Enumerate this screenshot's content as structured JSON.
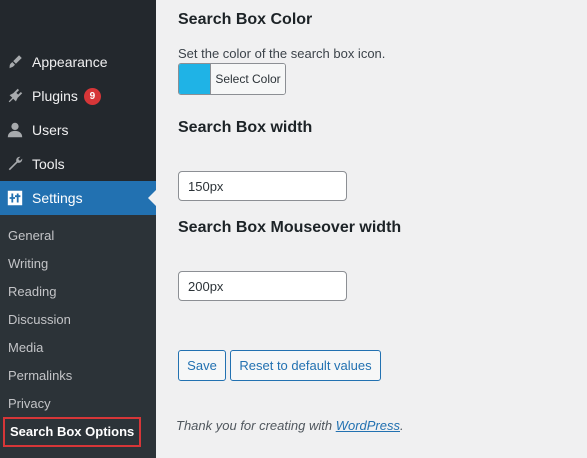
{
  "sidebar": {
    "menu": [
      {
        "label": "Appearance",
        "icon": "paintbrush-icon"
      },
      {
        "label": "Plugins",
        "icon": "plugin-icon",
        "badge": "9"
      },
      {
        "label": "Users",
        "icon": "user-icon"
      },
      {
        "label": "Tools",
        "icon": "wrench-icon"
      },
      {
        "label": "Settings",
        "icon": "settings-icon",
        "active": true
      }
    ],
    "submenu": [
      "General",
      "Writing",
      "Reading",
      "Discussion",
      "Media",
      "Permalinks",
      "Privacy",
      "Search Box Options"
    ],
    "current_submenu": "Search Box Options",
    "colors": {
      "background": "#23282d",
      "active": "#2271b1",
      "badge": "#d63638"
    }
  },
  "settings": {
    "color": {
      "title": "Search Box Color",
      "description": "Set the color of the search box icon.",
      "button_label": "Select Color",
      "value": "#1fb3e6"
    },
    "width": {
      "title": "Search Box width",
      "value": "150px"
    },
    "mouseover_width": {
      "title": "Search Box Mouseover width",
      "value": "200px"
    },
    "save_label": "Save",
    "reset_label": "Reset to default values"
  },
  "footer": {
    "text": "Thank you for creating with ",
    "link": "WordPress",
    "suffix": "."
  }
}
